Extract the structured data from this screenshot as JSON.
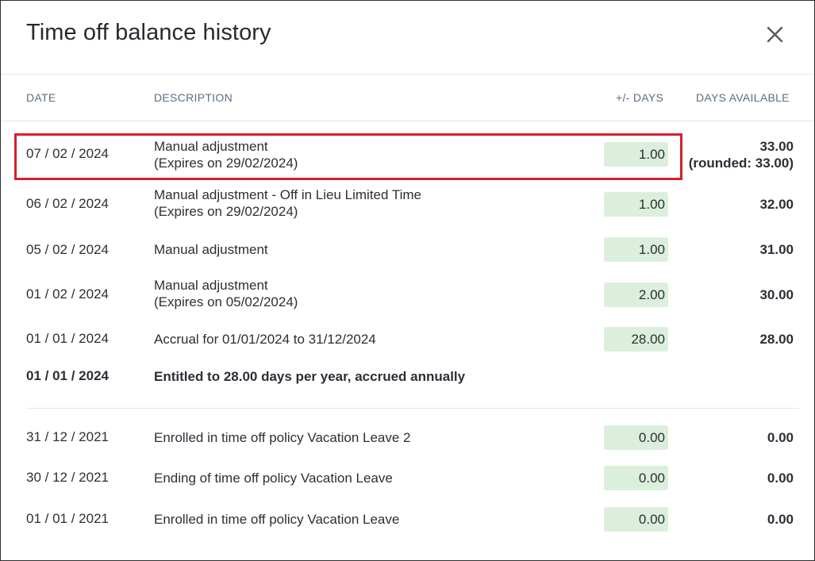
{
  "dialog": {
    "title": "Time off balance history",
    "close_label": "close"
  },
  "columns": {
    "date": "DATE",
    "description": "DESCRIPTION",
    "days": "+/- DAYS",
    "available": "DAYS AVAILABLE"
  },
  "rows": [
    {
      "date": "07 / 02 / 2024",
      "desc_line1": "Manual adjustment",
      "desc_line2": "(Expires on 29/02/2024)",
      "days": "1.00",
      "available": "33.00",
      "available_note": "(rounded: 33.00)",
      "highlighted": true
    },
    {
      "date": "06 / 02 / 2024",
      "desc_line1": "Manual adjustment - Off in Lieu Limited Time",
      "desc_line2": "(Expires on 29/02/2024)",
      "days": "1.00",
      "available": "32.00"
    },
    {
      "date": "05 / 02 / 2024",
      "desc_line1": "Manual adjustment",
      "days": "1.00",
      "available": "31.00"
    },
    {
      "date": "01 / 02 / 2024",
      "desc_line1": "Manual adjustment",
      "desc_line2": "(Expires on 05/02/2024)",
      "days": "2.00",
      "available": "30.00"
    },
    {
      "date": "01 / 01 / 2024",
      "desc_line1": "Accrual for 01/01/2024 to 31/12/2024",
      "days": "28.00",
      "available": "28.00"
    },
    {
      "date": "01 / 01 / 2024",
      "desc_line1": "Entitled to 28.00 days per year, accrued annually",
      "bold": true
    },
    {
      "date": "31 / 12 / 2021",
      "desc_line1": "Enrolled in time off policy Vacation Leave 2",
      "days": "0.00",
      "available": "0.00"
    },
    {
      "date": "30 / 12 / 2021",
      "desc_line1": "Ending of time off policy Vacation Leave",
      "days": "0.00",
      "available": "0.00"
    },
    {
      "date": "01 / 01 / 2021",
      "desc_line1": "Enrolled in time off policy Vacation Leave",
      "days": "0.00",
      "available": "0.00"
    }
  ],
  "colors": {
    "pill_bg": "#dcefdc",
    "highlight_border": "#d81f2a",
    "header_text": "#5b6e84"
  },
  "icons": {
    "close": "close-icon"
  }
}
